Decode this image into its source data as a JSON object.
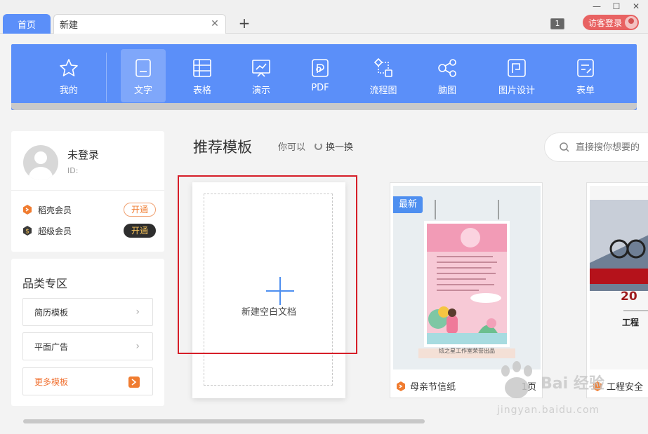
{
  "tabs": {
    "home": "首页",
    "new": "新建"
  },
  "titlebar": {
    "badge_count": "1",
    "guest_login": "访客登录"
  },
  "toolbar": {
    "items": [
      {
        "label": "我的",
        "icon": "star-icon"
      },
      {
        "label": "文字",
        "icon": "document-icon"
      },
      {
        "label": "表格",
        "icon": "table-icon"
      },
      {
        "label": "演示",
        "icon": "presentation-icon"
      },
      {
        "label": "PDF",
        "icon": "pdf-icon"
      },
      {
        "label": "流程图",
        "icon": "flowchart-icon"
      },
      {
        "label": "脑图",
        "icon": "mindmap-icon"
      },
      {
        "label": "图片设计",
        "icon": "image-design-icon"
      },
      {
        "label": "表单",
        "icon": "form-icon"
      }
    ],
    "active": "文字"
  },
  "user": {
    "name": "未登录",
    "id_label": "ID:",
    "memberships": [
      {
        "label": "稻壳会员",
        "button": "开通"
      },
      {
        "label": "超级会员",
        "button": "开通"
      }
    ]
  },
  "categories": {
    "title": "品类专区",
    "items": [
      "简历模板",
      "平面广告"
    ],
    "more": "更多模板"
  },
  "main": {
    "title": "推荐模板",
    "hint": "你可以",
    "refresh": "换一换",
    "search_placeholder": "直接搜你想要的"
  },
  "new_doc": {
    "label": "新建空白文档"
  },
  "templates": [
    {
      "badge": "最新",
      "name": "母亲节信纸",
      "pages": "1页",
      "poster_footer": "炫之星工作室荣誉出品"
    },
    {
      "name": "工程安全",
      "partial_text": "20",
      "partial_sub": "工程"
    }
  ],
  "watermark": {
    "text": "Bai 经验",
    "url": "jingyan.baidu.com"
  },
  "colors": {
    "accent": "#5b8ff9",
    "highlight": "#d61e28",
    "member_orange": "#f07c30"
  }
}
